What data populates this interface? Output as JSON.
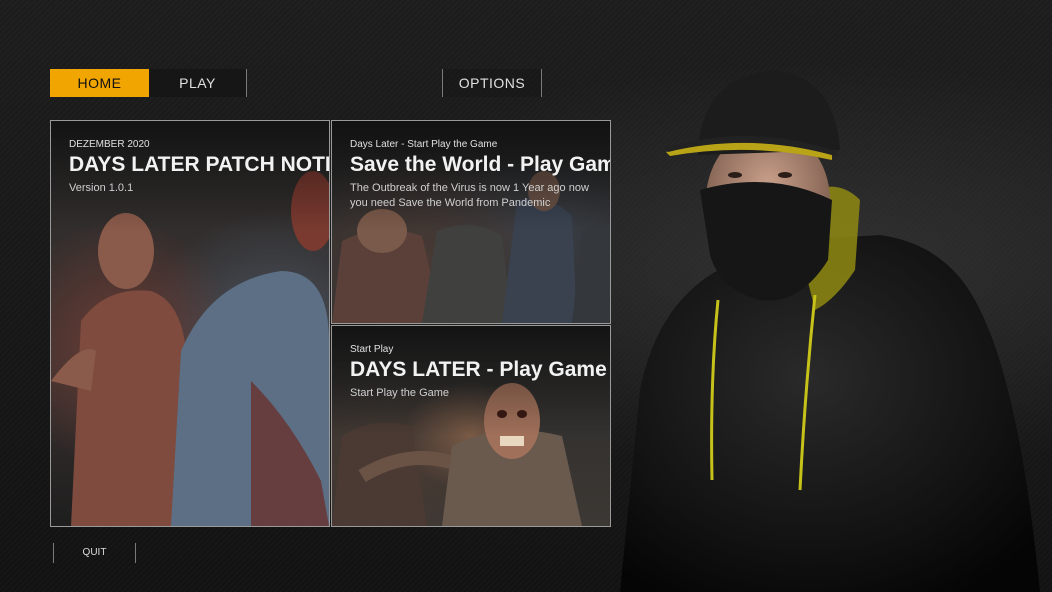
{
  "nav": {
    "home_label": "HOME",
    "play_label": "PLAY",
    "options_label": "OPTIONS"
  },
  "cards": {
    "patch": {
      "eyebrow": "DEZEMBER 2020",
      "title": "DAYS LATER PATCH NOTES",
      "subtitle": "Version 1.0.1"
    },
    "save_world": {
      "eyebrow": "Days Later - Start Play the Game",
      "title": "Save the World - Play Game",
      "description_line1": "The Outbreak of the Virus is now 1 Year ago now",
      "description_line2": "you need Save the World from Pandemic"
    },
    "days_later": {
      "eyebrow": "Start Play",
      "title": "DAYS LATER - Play Game",
      "subtitle": "Start Play the Game"
    }
  },
  "footer": {
    "quit_label": "QUIT"
  },
  "colors": {
    "accent": "#f0a500",
    "background": "#141414",
    "card_border": "#9a9a9a"
  }
}
